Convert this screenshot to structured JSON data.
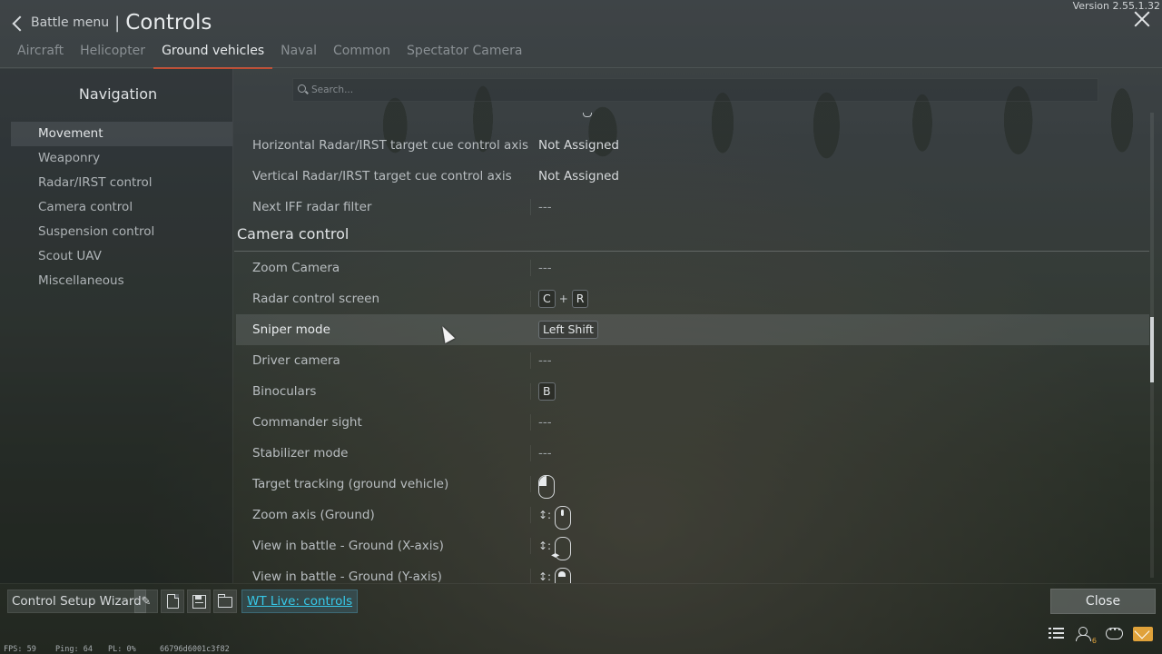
{
  "header": {
    "back_label": "Battle menu",
    "separator": "|",
    "title": "Controls",
    "version": "Version 2.55.1.32"
  },
  "tabs": [
    {
      "label": "Aircraft",
      "active": false
    },
    {
      "label": "Helicopter",
      "active": false
    },
    {
      "label": "Ground vehicles",
      "active": true
    },
    {
      "label": "Naval",
      "active": false
    },
    {
      "label": "Common",
      "active": false
    },
    {
      "label": "Spectator Camera",
      "active": false
    }
  ],
  "sidebar": {
    "title": "Navigation",
    "items": [
      {
        "label": "Movement",
        "active": true
      },
      {
        "label": "Weaponry",
        "active": false
      },
      {
        "label": "Radar/IRST control",
        "active": false
      },
      {
        "label": "Camera control",
        "active": false
      },
      {
        "label": "Suspension control",
        "active": false
      },
      {
        "label": "Scout UAV",
        "active": false
      },
      {
        "label": "Miscellaneous",
        "active": false
      }
    ]
  },
  "search": {
    "placeholder": "Search...",
    "value": ""
  },
  "rows_top": [
    {
      "label": "Horizontal Radar/IRST target cue control axis",
      "value": "Not Assigned"
    },
    {
      "label": "Vertical Radar/IRST target cue control axis",
      "value": "Not Assigned"
    },
    {
      "label": "Next IFF radar filter",
      "value": "---"
    }
  ],
  "section_camera": {
    "label": "Camera control"
  },
  "rows_camera": [
    {
      "label": "Zoom Camera",
      "value": "---"
    },
    {
      "label": "Radar control screen",
      "key1": "C",
      "plus": "+",
      "key2": "R"
    },
    {
      "label": "Sniper mode",
      "key1": "Left Shift",
      "highlighted": true
    },
    {
      "label": "Driver camera",
      "value": "---"
    },
    {
      "label": "Binoculars",
      "key1": "B"
    },
    {
      "label": "Commander sight",
      "value": "---"
    },
    {
      "label": "Stabilizer mode",
      "value": "---"
    },
    {
      "label": "Target tracking (ground vehicle)",
      "icon": "mouse-left-button-icon"
    },
    {
      "label": "Zoom axis (Ground)",
      "prefix": "↕:",
      "icon": "mouse-wheel-icon"
    },
    {
      "label": "View in battle - Ground (X-axis)",
      "prefix": "↕:",
      "icon": "mouse-x-axis-icon"
    },
    {
      "label": "View in battle - Ground (Y-axis)",
      "prefix": "↕:",
      "icon": "mouse-y-axis-icon"
    }
  ],
  "bottom": {
    "wizard_label": "Control Setup Wizard",
    "wtlive_label": "WT Live: controls",
    "close_label": "Close",
    "icons": [
      "wheel-settings-icon",
      "new-preset-icon",
      "save-preset-icon",
      "open-preset-icon"
    ]
  },
  "status": {
    "fps": "FPS: 59",
    "ping": "Ping: 64",
    "pl": "PL: 0%",
    "session_id": "66796d6001c3f82",
    "friends_badge": "6"
  },
  "colors": {
    "tab_active_underline": "#c04a2f",
    "wtlive_link": "#37c8e8",
    "mail_badge": "#e0a23a"
  }
}
